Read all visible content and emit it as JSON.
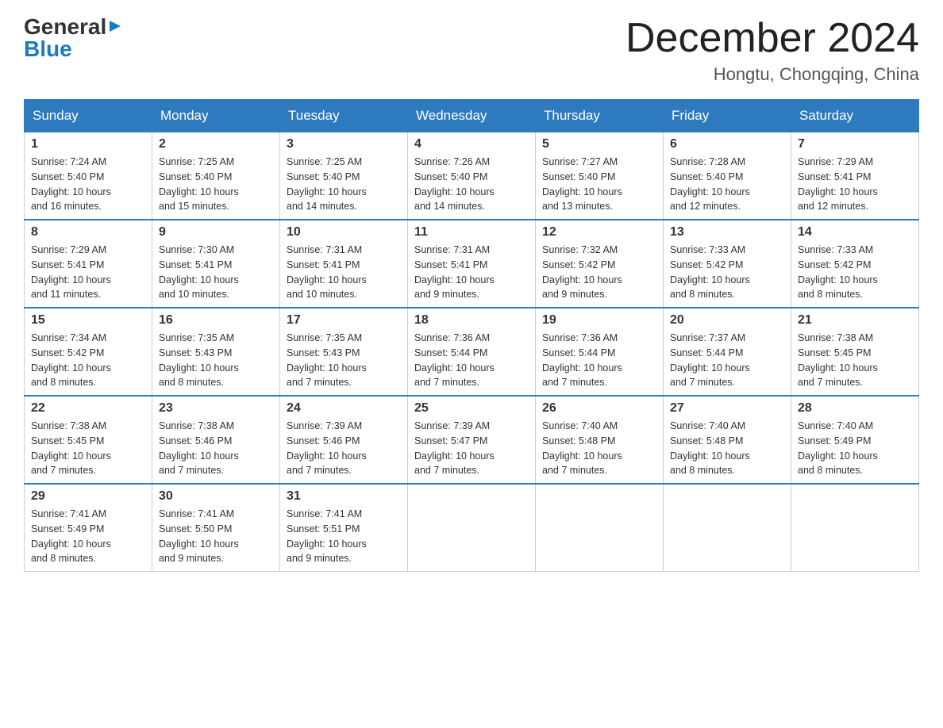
{
  "logo": {
    "general": "General",
    "arrow": "▶",
    "blue": "Blue"
  },
  "header": {
    "month_year": "December 2024",
    "location": "Hongtu, Chongqing, China"
  },
  "days_of_week": [
    "Sunday",
    "Monday",
    "Tuesday",
    "Wednesday",
    "Thursday",
    "Friday",
    "Saturday"
  ],
  "weeks": [
    [
      {
        "day": "1",
        "sunrise": "7:24 AM",
        "sunset": "5:40 PM",
        "daylight": "10 hours and 16 minutes."
      },
      {
        "day": "2",
        "sunrise": "7:25 AM",
        "sunset": "5:40 PM",
        "daylight": "10 hours and 15 minutes."
      },
      {
        "day": "3",
        "sunrise": "7:25 AM",
        "sunset": "5:40 PM",
        "daylight": "10 hours and 14 minutes."
      },
      {
        "day": "4",
        "sunrise": "7:26 AM",
        "sunset": "5:40 PM",
        "daylight": "10 hours and 14 minutes."
      },
      {
        "day": "5",
        "sunrise": "7:27 AM",
        "sunset": "5:40 PM",
        "daylight": "10 hours and 13 minutes."
      },
      {
        "day": "6",
        "sunrise": "7:28 AM",
        "sunset": "5:40 PM",
        "daylight": "10 hours and 12 minutes."
      },
      {
        "day": "7",
        "sunrise": "7:29 AM",
        "sunset": "5:41 PM",
        "daylight": "10 hours and 12 minutes."
      }
    ],
    [
      {
        "day": "8",
        "sunrise": "7:29 AM",
        "sunset": "5:41 PM",
        "daylight": "10 hours and 11 minutes."
      },
      {
        "day": "9",
        "sunrise": "7:30 AM",
        "sunset": "5:41 PM",
        "daylight": "10 hours and 10 minutes."
      },
      {
        "day": "10",
        "sunrise": "7:31 AM",
        "sunset": "5:41 PM",
        "daylight": "10 hours and 10 minutes."
      },
      {
        "day": "11",
        "sunrise": "7:31 AM",
        "sunset": "5:41 PM",
        "daylight": "10 hours and 9 minutes."
      },
      {
        "day": "12",
        "sunrise": "7:32 AM",
        "sunset": "5:42 PM",
        "daylight": "10 hours and 9 minutes."
      },
      {
        "day": "13",
        "sunrise": "7:33 AM",
        "sunset": "5:42 PM",
        "daylight": "10 hours and 8 minutes."
      },
      {
        "day": "14",
        "sunrise": "7:33 AM",
        "sunset": "5:42 PM",
        "daylight": "10 hours and 8 minutes."
      }
    ],
    [
      {
        "day": "15",
        "sunrise": "7:34 AM",
        "sunset": "5:42 PM",
        "daylight": "10 hours and 8 minutes."
      },
      {
        "day": "16",
        "sunrise": "7:35 AM",
        "sunset": "5:43 PM",
        "daylight": "10 hours and 8 minutes."
      },
      {
        "day": "17",
        "sunrise": "7:35 AM",
        "sunset": "5:43 PM",
        "daylight": "10 hours and 7 minutes."
      },
      {
        "day": "18",
        "sunrise": "7:36 AM",
        "sunset": "5:44 PM",
        "daylight": "10 hours and 7 minutes."
      },
      {
        "day": "19",
        "sunrise": "7:36 AM",
        "sunset": "5:44 PM",
        "daylight": "10 hours and 7 minutes."
      },
      {
        "day": "20",
        "sunrise": "7:37 AM",
        "sunset": "5:44 PM",
        "daylight": "10 hours and 7 minutes."
      },
      {
        "day": "21",
        "sunrise": "7:38 AM",
        "sunset": "5:45 PM",
        "daylight": "10 hours and 7 minutes."
      }
    ],
    [
      {
        "day": "22",
        "sunrise": "7:38 AM",
        "sunset": "5:45 PM",
        "daylight": "10 hours and 7 minutes."
      },
      {
        "day": "23",
        "sunrise": "7:38 AM",
        "sunset": "5:46 PM",
        "daylight": "10 hours and 7 minutes."
      },
      {
        "day": "24",
        "sunrise": "7:39 AM",
        "sunset": "5:46 PM",
        "daylight": "10 hours and 7 minutes."
      },
      {
        "day": "25",
        "sunrise": "7:39 AM",
        "sunset": "5:47 PM",
        "daylight": "10 hours and 7 minutes."
      },
      {
        "day": "26",
        "sunrise": "7:40 AM",
        "sunset": "5:48 PM",
        "daylight": "10 hours and 7 minutes."
      },
      {
        "day": "27",
        "sunrise": "7:40 AM",
        "sunset": "5:48 PM",
        "daylight": "10 hours and 8 minutes."
      },
      {
        "day": "28",
        "sunrise": "7:40 AM",
        "sunset": "5:49 PM",
        "daylight": "10 hours and 8 minutes."
      }
    ],
    [
      {
        "day": "29",
        "sunrise": "7:41 AM",
        "sunset": "5:49 PM",
        "daylight": "10 hours and 8 minutes."
      },
      {
        "day": "30",
        "sunrise": "7:41 AM",
        "sunset": "5:50 PM",
        "daylight": "10 hours and 9 minutes."
      },
      {
        "day": "31",
        "sunrise": "7:41 AM",
        "sunset": "5:51 PM",
        "daylight": "10 hours and 9 minutes."
      },
      null,
      null,
      null,
      null
    ]
  ],
  "labels": {
    "sunrise": "Sunrise:",
    "sunset": "Sunset:",
    "daylight": "Daylight:"
  }
}
